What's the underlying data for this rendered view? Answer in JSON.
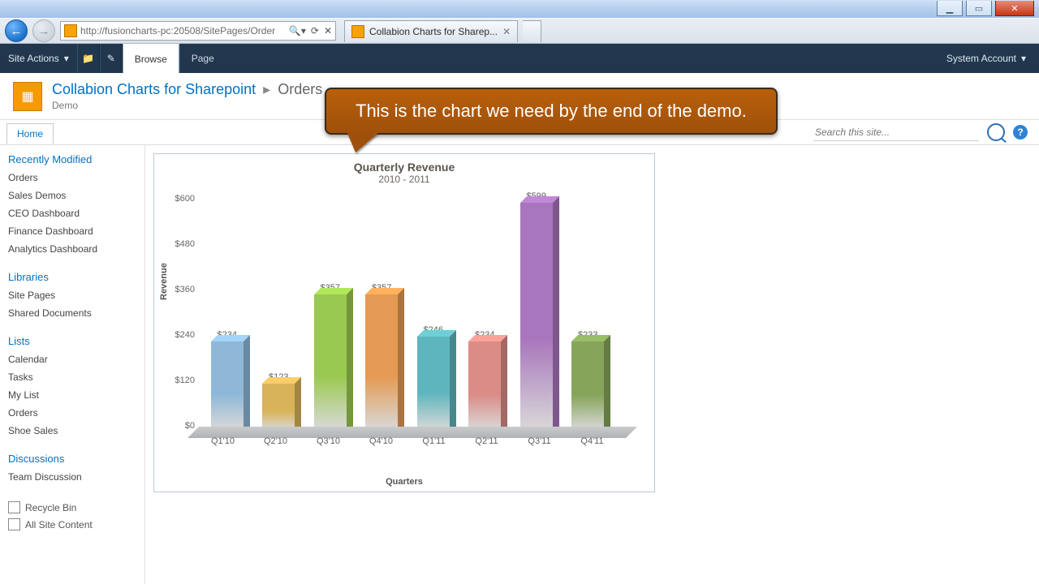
{
  "window": {
    "min": "▁",
    "max": "▭",
    "close": "✕"
  },
  "ie": {
    "url": "http://fusioncharts-pc:20508/SitePages/Order",
    "tab_title": "Collabion Charts for Sharep..."
  },
  "ribbon": {
    "site_actions": "Site Actions",
    "browse": "Browse",
    "page": "Page",
    "account": "System Account"
  },
  "header": {
    "site": "Collabion Charts for Sharepoint",
    "page": "Orders",
    "desc": "Demo"
  },
  "callout": "This is the chart we need by the end of the demo.",
  "subnav": {
    "home": "Home",
    "search_placeholder": "Search this site..."
  },
  "leftnav": {
    "recent_h": "Recently Modified",
    "recent": [
      "Orders",
      "Sales Demos",
      "CEO Dashboard",
      "Finance Dashboard",
      "Analytics Dashboard"
    ],
    "lib_h": "Libraries",
    "lib": [
      "Site Pages",
      "Shared Documents"
    ],
    "lists_h": "Lists",
    "lists": [
      "Calendar",
      "Tasks",
      "My List",
      "Orders",
      "Shoe Sales"
    ],
    "disc_h": "Discussions",
    "disc": [
      "Team Discussion"
    ],
    "recycle": "Recycle Bin",
    "allcontent": "All Site Content"
  },
  "chart_data": {
    "type": "bar",
    "title": "Quarterly Revenue",
    "subtitle": "2010 - 2011",
    "ylabel": "Revenue",
    "xlabel": "Quarters",
    "ylim": [
      0,
      600
    ],
    "yticks": [
      0,
      120,
      240,
      360,
      480,
      600
    ],
    "categories": [
      "Q1'10",
      "Q2'10",
      "Q3'10",
      "Q4'10",
      "Q1'11",
      "Q2'11",
      "Q3'11",
      "Q4'11"
    ],
    "values": [
      234,
      123,
      357,
      357,
      246,
      234,
      599,
      233
    ],
    "value_labels": [
      "$234",
      "$123",
      "$357",
      "$357",
      "$246",
      "$234",
      "$599",
      "$233"
    ],
    "colors": [
      "#8fb8d8",
      "#d9b35a",
      "#9ac94f",
      "#e49a52",
      "#5eb5bd",
      "#db8c86",
      "#a876bc",
      "#86a45a"
    ]
  }
}
